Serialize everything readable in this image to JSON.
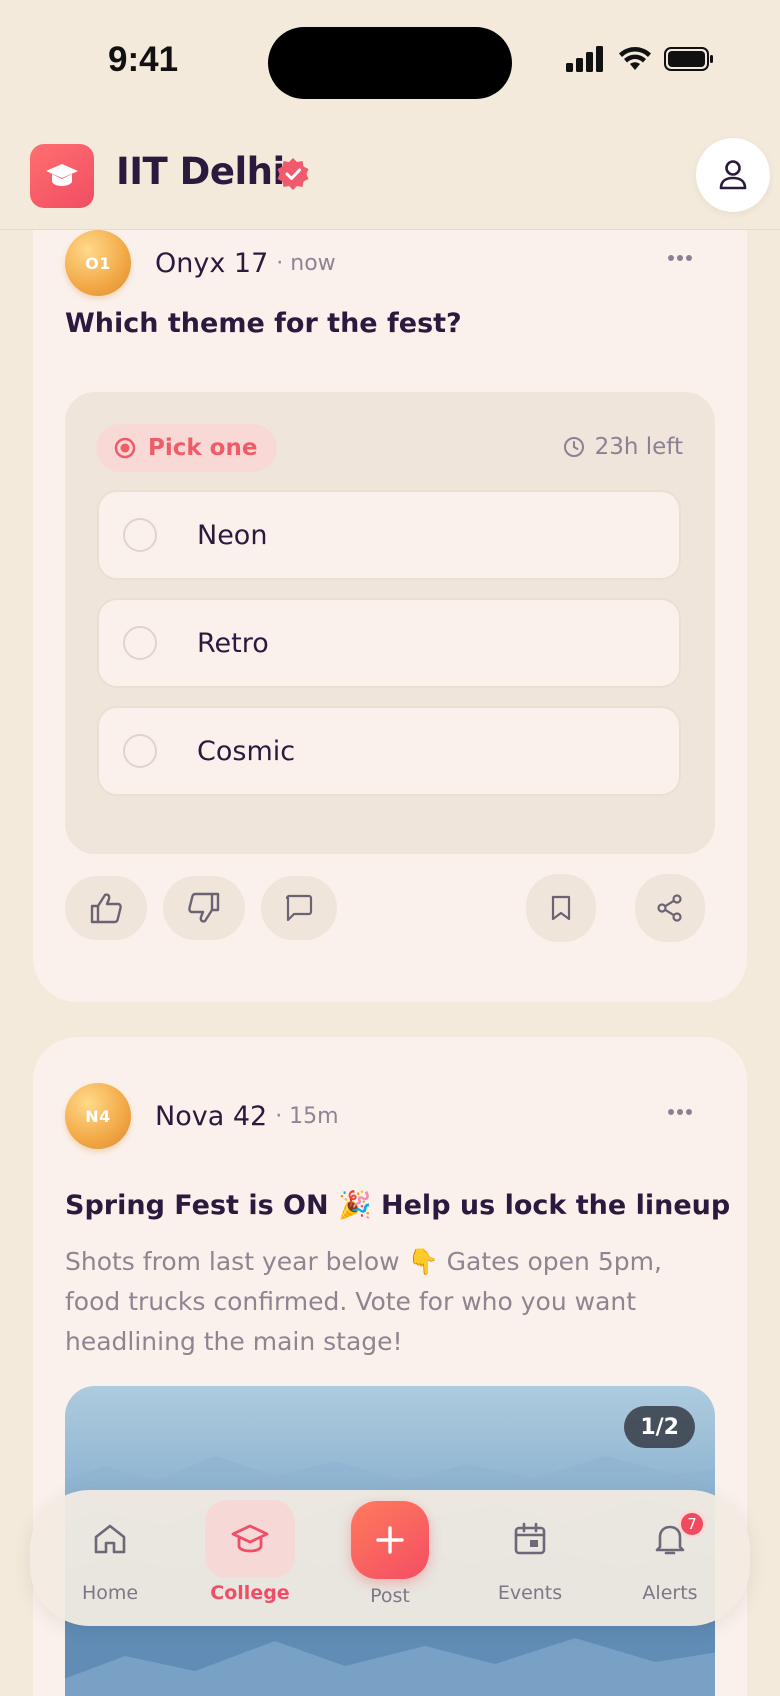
{
  "status_bar": {
    "time": "9:41"
  },
  "header": {
    "college_name": "IIT Delhi",
    "logo_icon": "graduation-cap-icon",
    "verified_icon": "verified-badge-icon",
    "profile_icon": "user-icon"
  },
  "posts": [
    {
      "avatar_initials": "O1",
      "author": "Onyx 17",
      "time": "· now",
      "title": "Which theme for the fest?",
      "poll": {
        "badge": "Pick one",
        "time_left": "23h left",
        "options": [
          "Neon",
          "Retro",
          "Cosmic"
        ]
      }
    },
    {
      "avatar_initials": "N4",
      "author": "Nova 42",
      "time": "· 15m",
      "title": "Spring Fest is ON 🎉  Help us lock the lineup",
      "body": "Shots from last year below 👇 Gates open 5pm, food trucks confirmed. Vote for who you want headlining the main stage!",
      "image_counter": "1/2"
    }
  ],
  "nav": {
    "items": [
      {
        "label": "Home",
        "icon": "home-icon"
      },
      {
        "label": "College",
        "icon": "graduation-cap-icon"
      },
      {
        "label": "Post",
        "icon": "plus-icon"
      },
      {
        "label": "Events",
        "icon": "calendar-icon"
      },
      {
        "label": "Alerts",
        "icon": "bell-icon"
      }
    ],
    "alerts_badge": "7",
    "active": "College"
  },
  "colors": {
    "background": "#f3eadc",
    "card": "#fbf1ec",
    "accent": "#f14d63",
    "text": "#2b1a3d"
  }
}
